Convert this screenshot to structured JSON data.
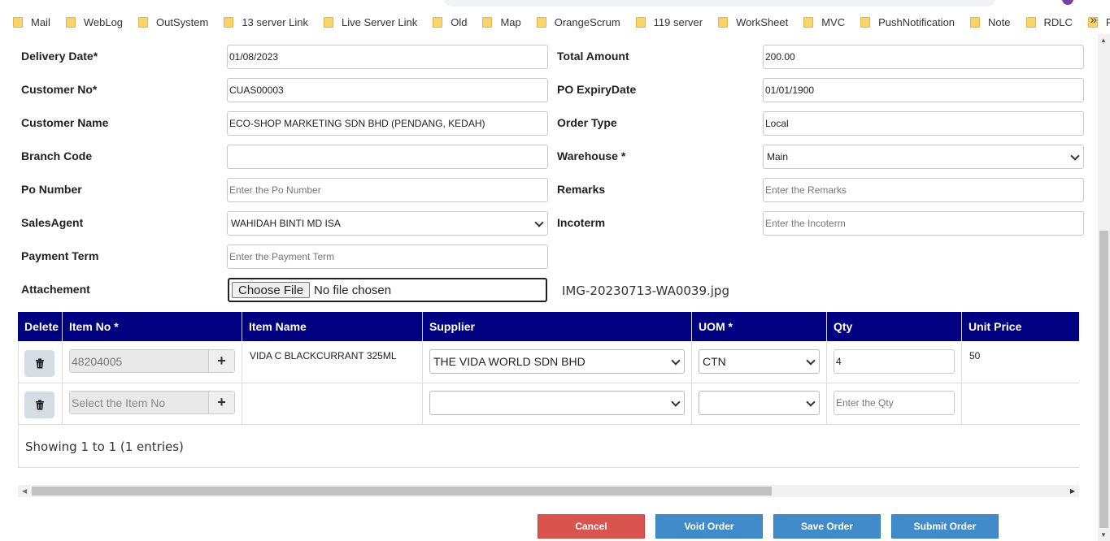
{
  "bookmarks": {
    "items": [
      "Mail",
      "WebLog",
      "OutSystem",
      "13 server Link",
      "Live Server Link",
      "Old",
      "Map",
      "OrangeScrum",
      "119 server",
      "WorkSheet",
      "MVC",
      "PushNotification",
      "Note",
      "RDLC",
      "React"
    ],
    "more": "»"
  },
  "form": {
    "delivery_date": {
      "label": "Delivery Date*",
      "value": "01/08/2023"
    },
    "customer_no": {
      "label": "Customer No*",
      "value": "CUAS00003"
    },
    "customer_name": {
      "label": "Customer Name",
      "value": "ECO-SHOP MARKETING SDN BHD (PENDANG, KEDAH)"
    },
    "branch_code": {
      "label": "Branch Code",
      "value": ""
    },
    "po_number": {
      "label": "Po Number",
      "placeholder": "Enter the Po Number"
    },
    "sales_agent": {
      "label": "SalesAgent",
      "value": "WAHIDAH BINTI MD ISA"
    },
    "payment_term": {
      "label": "Payment Term",
      "placeholder": "Enter the Payment Term"
    },
    "attachment": {
      "label": "Attachement",
      "button": "Choose File",
      "status": "No file chosen",
      "filename": "IMG-20230713-WA0039.jpg"
    },
    "total_amount": {
      "label": "Total Amount",
      "value": "200.00"
    },
    "po_expiry": {
      "label": "PO ExpiryDate",
      "value": "01/01/1900"
    },
    "order_type": {
      "label": "Order Type",
      "value": "Local"
    },
    "warehouse": {
      "label": "Warehouse *",
      "value": "Main"
    },
    "remarks": {
      "label": "Remarks",
      "placeholder": "Enter the Remarks"
    },
    "incoterm": {
      "label": "Incoterm",
      "placeholder": "Enter the Incoterm"
    }
  },
  "table": {
    "headers": {
      "delete": "Delete",
      "item_no": "Item No *",
      "item_name": "Item Name",
      "supplier": "Supplier",
      "uom": "UOM *",
      "qty": "Qty",
      "unit_price": "Unit Price"
    },
    "rows": [
      {
        "item_no": "48204005",
        "item_name": "VIDA C BLACKCURRANT 325ML",
        "supplier": "THE VIDA WORLD SDN BHD",
        "uom": "CTN",
        "qty": "4",
        "unit_price": "50"
      },
      {
        "item_no_placeholder": "Select the Item No",
        "item_name": "",
        "supplier": "",
        "uom": "",
        "qty_placeholder": "Enter the Qty",
        "unit_price": ""
      }
    ],
    "showing": "Showing 1 to 1 (1 entries)"
  },
  "buttons": {
    "cancel": "Cancel",
    "void": "Void Order",
    "save": "Save Order",
    "submit": "Submit Order"
  },
  "colors": {
    "table_header": "#000080",
    "cancel": "#d9534f",
    "primary": "#428bca"
  }
}
